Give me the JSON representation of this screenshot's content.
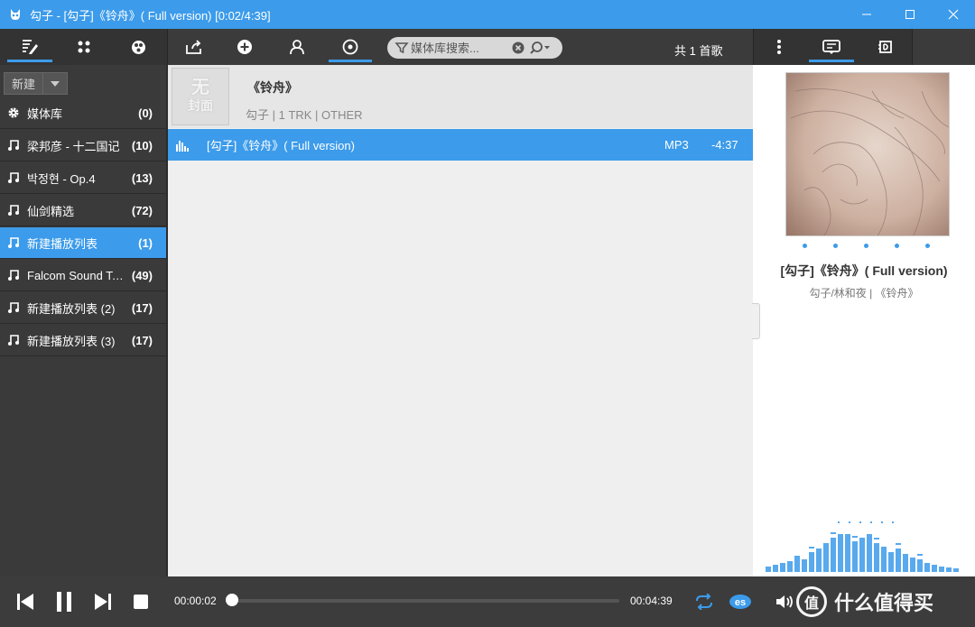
{
  "window": {
    "title": "勾子 - [勾子]《铃舟》( Full version) [0:02/4:39]"
  },
  "toolbar": {
    "search_placeholder": "媒体库搜索...",
    "track_count": "共 1 首歌"
  },
  "sidebar": {
    "new_button": "新建",
    "items": [
      {
        "icon": "gear-icon",
        "name": "媒体库",
        "count": "(0)"
      },
      {
        "icon": "music-note-icon",
        "name": "梁邦彦 - 十二国记",
        "count": "(10)"
      },
      {
        "icon": "music-note-icon",
        "name": "박정현 - Op.4",
        "count": "(13)"
      },
      {
        "icon": "music-note-icon",
        "name": "仙剑精选",
        "count": "(72)"
      },
      {
        "icon": "music-note-icon",
        "name": "新建播放列表",
        "count": "(1)",
        "selected": true
      },
      {
        "icon": "music-note-icon",
        "name": "Falcom Sound Team",
        "count": "(49)"
      },
      {
        "icon": "music-note-icon",
        "name": "新建播放列表 (2)",
        "count": "(17)"
      },
      {
        "icon": "music-note-icon",
        "name": "新建播放列表 (3)",
        "count": "(17)"
      }
    ]
  },
  "album": {
    "cover_text_1": "无",
    "cover_text_2": "封面",
    "title": "《铃舟》",
    "meta": "勾子 | 1 TRK | OTHER"
  },
  "tracks": [
    {
      "name": "[勾子]《铃舟》( Full version)",
      "format": "MP3",
      "duration": "-4:37"
    }
  ],
  "now_playing": {
    "title": "[勾子]《铃舟》( Full version)",
    "subtitle": "勾子/林和夜 | 《铃舟》"
  },
  "player": {
    "elapsed": "00:00:02",
    "total": "00:04:39",
    "progress_fraction": 0.007
  },
  "watermark": {
    "badge": "值",
    "text": "什么值得买"
  },
  "colors": {
    "accent": "#3c9bea",
    "dark_bg": "#3a3a3a"
  }
}
